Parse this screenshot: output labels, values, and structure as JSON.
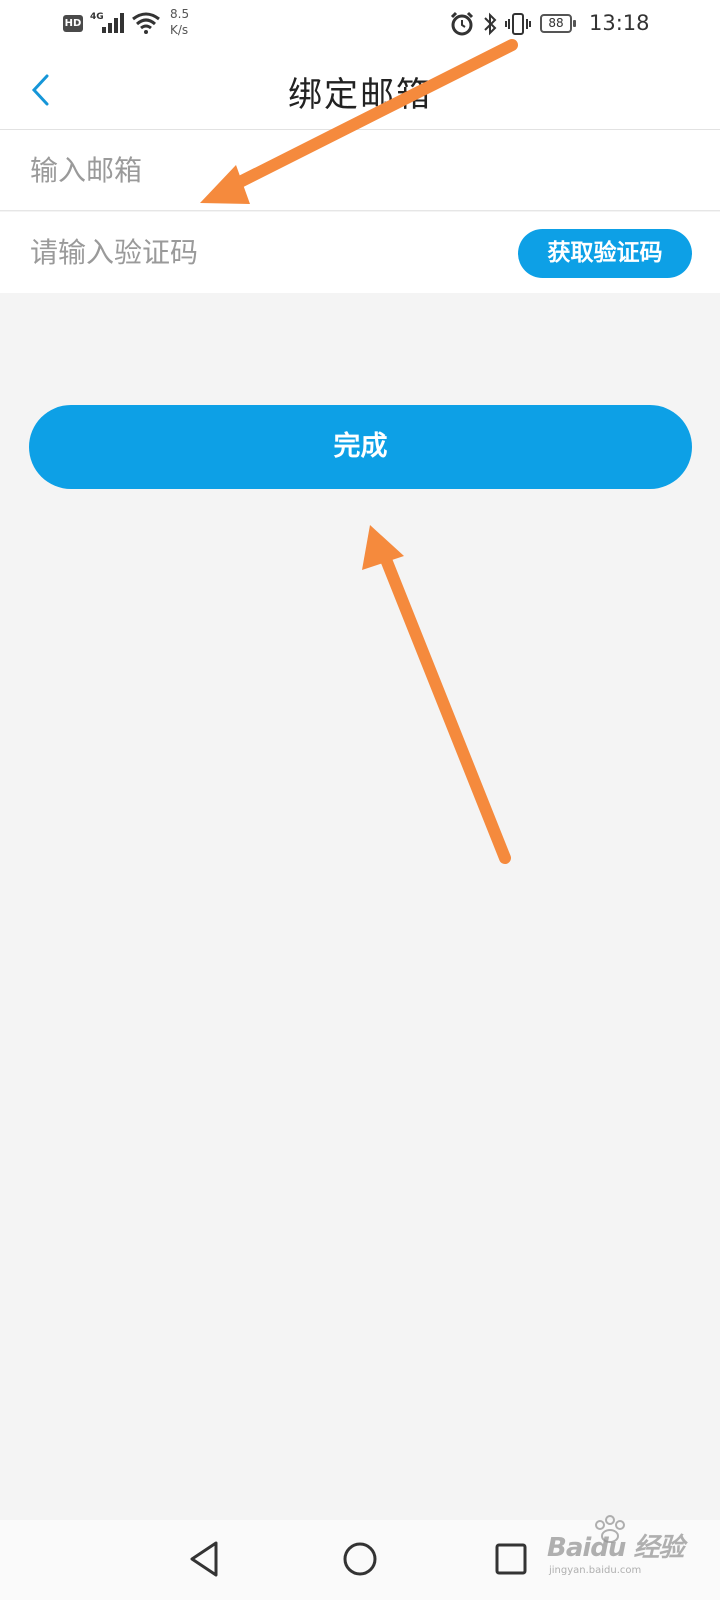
{
  "status_bar": {
    "hd_badge": "HD",
    "network_type": "4G",
    "speed_value": "8.5",
    "speed_unit": "K/s",
    "battery_level": "88",
    "time": "13:18"
  },
  "header": {
    "title": "绑定邮箱"
  },
  "form": {
    "email_placeholder": "输入邮箱",
    "code_placeholder": "请输入验证码",
    "get_code_label": "获取验证码",
    "submit_label": "完成"
  },
  "watermark": {
    "text": "Baidu 经验",
    "subtext": "jingyan.baidu.com"
  },
  "colors": {
    "accent": "#0da0e6",
    "annotation_arrow": "#f58a3d",
    "background": "#f4f4f4"
  }
}
